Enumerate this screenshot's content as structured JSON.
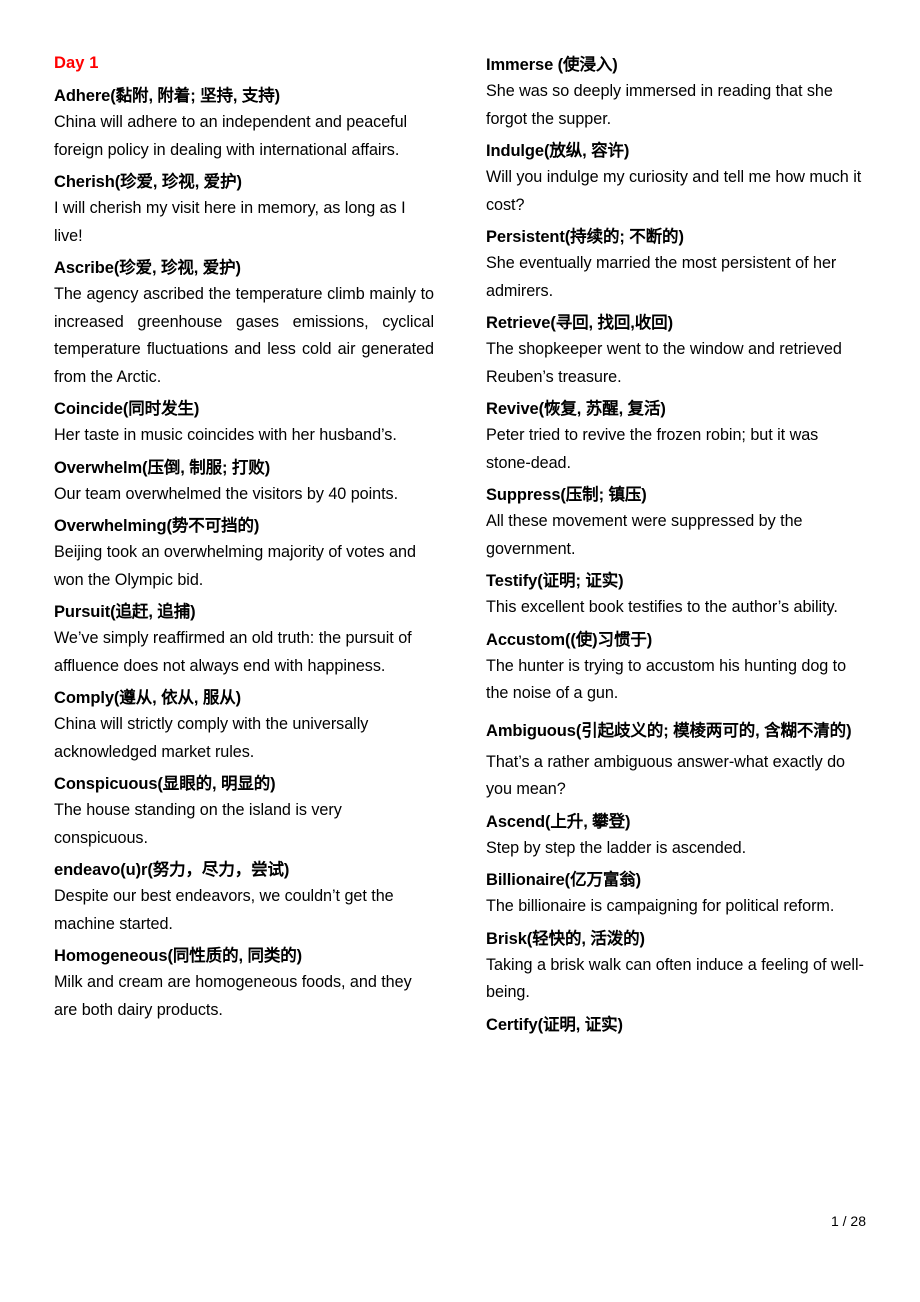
{
  "document": {
    "heading": "Day 1",
    "heading_color": "#FF0000",
    "footer": "1 / 28"
  },
  "left_column": {
    "entries": [
      {
        "term": "Adhere(黏附, 附着; 坚持, 支持)",
        "example": "China will adhere to an independent and peaceful foreign policy in dealing with international affairs.",
        "justified": false
      },
      {
        "term": "Cherish(珍爱, 珍视, 爱护)",
        "example": "I will cherish my visit here in memory, as long as I live!",
        "justified": false
      },
      {
        "term": "Ascribe(珍爱, 珍视, 爱护)",
        "example": "The agency ascribed the temperature climb mainly to increased greenhouse gases emissions, cyclical temperature fluctuations and less cold air generated from the Arctic.",
        "justified": true
      },
      {
        "term": "Coincide(同时发生)",
        "example": "Her taste in music coincides with her husband’s.",
        "justified": false
      },
      {
        "term": "Overwhelm(压倒, 制服; 打败)",
        "example": "Our team overwhelmed the visitors by 40 points.",
        "justified": false
      },
      {
        "term": "Overwhelming(势不可挡的)",
        "example": "Beijing took an overwhelming majority of votes and won the Olympic bid.",
        "justified": false
      },
      {
        "term": "Pursuit(追赶, 追捕)",
        "example": "We’ve simply reaffirmed an old truth: the pursuit of affluence does not always end with happiness.",
        "justified": false
      },
      {
        "term": "Comply(遵从, 依从, 服从)",
        "example": "China will strictly comply with the universally acknowledged market rules.",
        "justified": false
      },
      {
        "term": "Conspicuous(显眼的, 明显的)",
        "example": "The house standing on the island is very conspicuous.",
        "justified": false
      },
      {
        "term": "endeavo(u)r(努力，尽力，尝试)",
        "example": "Despite our best endeavors, we couldn’t get the machine started.",
        "justified": false
      },
      {
        "term": "Homogeneous(同性质的, 同类的)",
        "example": "Milk and cream are homogeneous foods, and they are both dairy products.",
        "justified": false
      }
    ]
  },
  "right_column": {
    "entries": [
      {
        "term": "Immerse (使浸入)",
        "example": "She was so deeply immersed in reading that she forgot the supper.",
        "justified": false
      },
      {
        "term": "Indulge(放纵, 容许)",
        "example": "Will you indulge my curiosity and tell me how much it cost?",
        "justified": false
      },
      {
        "term": "Persistent(持续的; 不断的)",
        "example": "She eventually married the most persistent of her admirers.",
        "justified": false
      },
      {
        "term": "Retrieve(寻回, 找回,收回)",
        "example": "The shopkeeper went to the window and retrieved Reuben’s treasure.",
        "justified": false
      },
      {
        "term": "Revive(恢复, 苏醒, 复活)",
        "example": "Peter tried to revive the frozen robin; but it was stone-dead.",
        "justified": false
      },
      {
        "term": "Suppress(压制; 镇压)",
        "example": "All these movement were suppressed by the government.",
        "justified": false
      },
      {
        "term": "Testify(证明; 证实)",
        "example": "This excellent book testifies to the author’s ability.",
        "justified": false
      },
      {
        "term": "Accustom((使)习惯于)",
        "example": "The hunter is trying to accustom his hunting dog to the noise of a gun.",
        "justified": false
      },
      {
        "term": "Ambiguous(引起歧义的; 模棱两可的, 含糊不清的)",
        "example": "That’s a rather ambiguous answer-what exactly do you mean?",
        "justified": false,
        "wrapped": true
      },
      {
        "term": "Ascend(上升, 攀登)",
        "example": "Step by step the ladder is ascended.",
        "justified": false
      },
      {
        "term": "Billionaire(亿万富翁)",
        "example": "The billionaire is campaigning for political reform.",
        "justified": false
      },
      {
        "term": "Brisk(轻快的, 活泼的)",
        "example": "Taking a brisk walk can often induce a feeling of well-being.",
        "justified": false
      },
      {
        "term": "Certify(证明, 证实)",
        "example": "",
        "justified": false
      }
    ]
  }
}
